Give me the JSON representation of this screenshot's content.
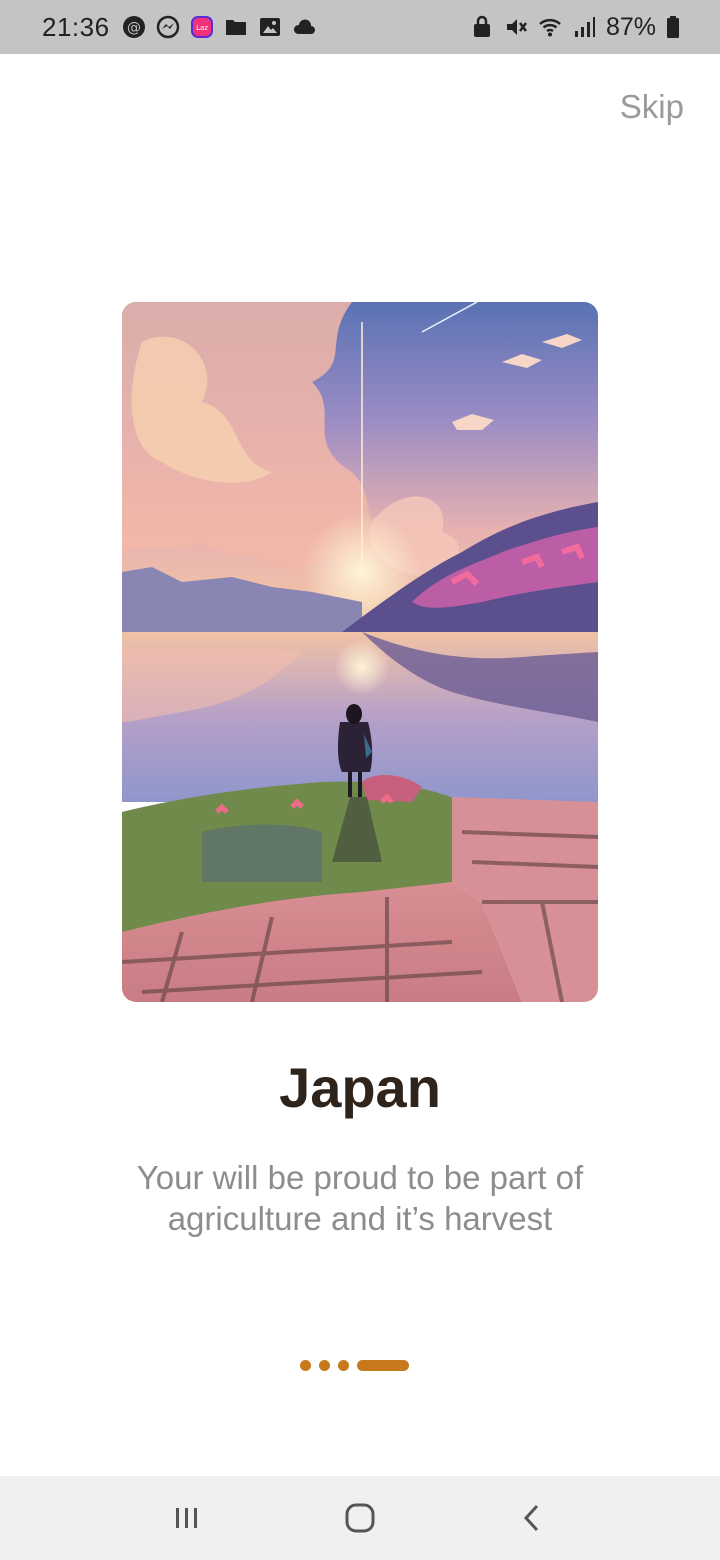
{
  "status_bar": {
    "time": "21:36",
    "battery": "87%",
    "left_icons": [
      "threads-icon",
      "messenger-icon",
      "lazada-icon",
      "folder-icon",
      "gallery-icon",
      "cloud-icon"
    ],
    "right_icons": [
      "lock-icon",
      "mute-icon",
      "wifi-icon",
      "signal-icon",
      "battery-icon"
    ]
  },
  "header": {
    "skip_label": "Skip"
  },
  "onboarding": {
    "title": "Japan",
    "subtitle": "Your will be proud to be part of agriculture and it’s harvest",
    "page_count": 4,
    "active_page": 4
  },
  "colors": {
    "accent": "#c77a1c",
    "title": "#2f241c",
    "subtitle": "#8d8d8d",
    "status_bar": "#c4c4c4",
    "nav_bar": "#f0f0f0"
  },
  "nav_bar": {
    "icons": [
      "recent-apps-icon",
      "home-icon",
      "back-icon"
    ]
  }
}
